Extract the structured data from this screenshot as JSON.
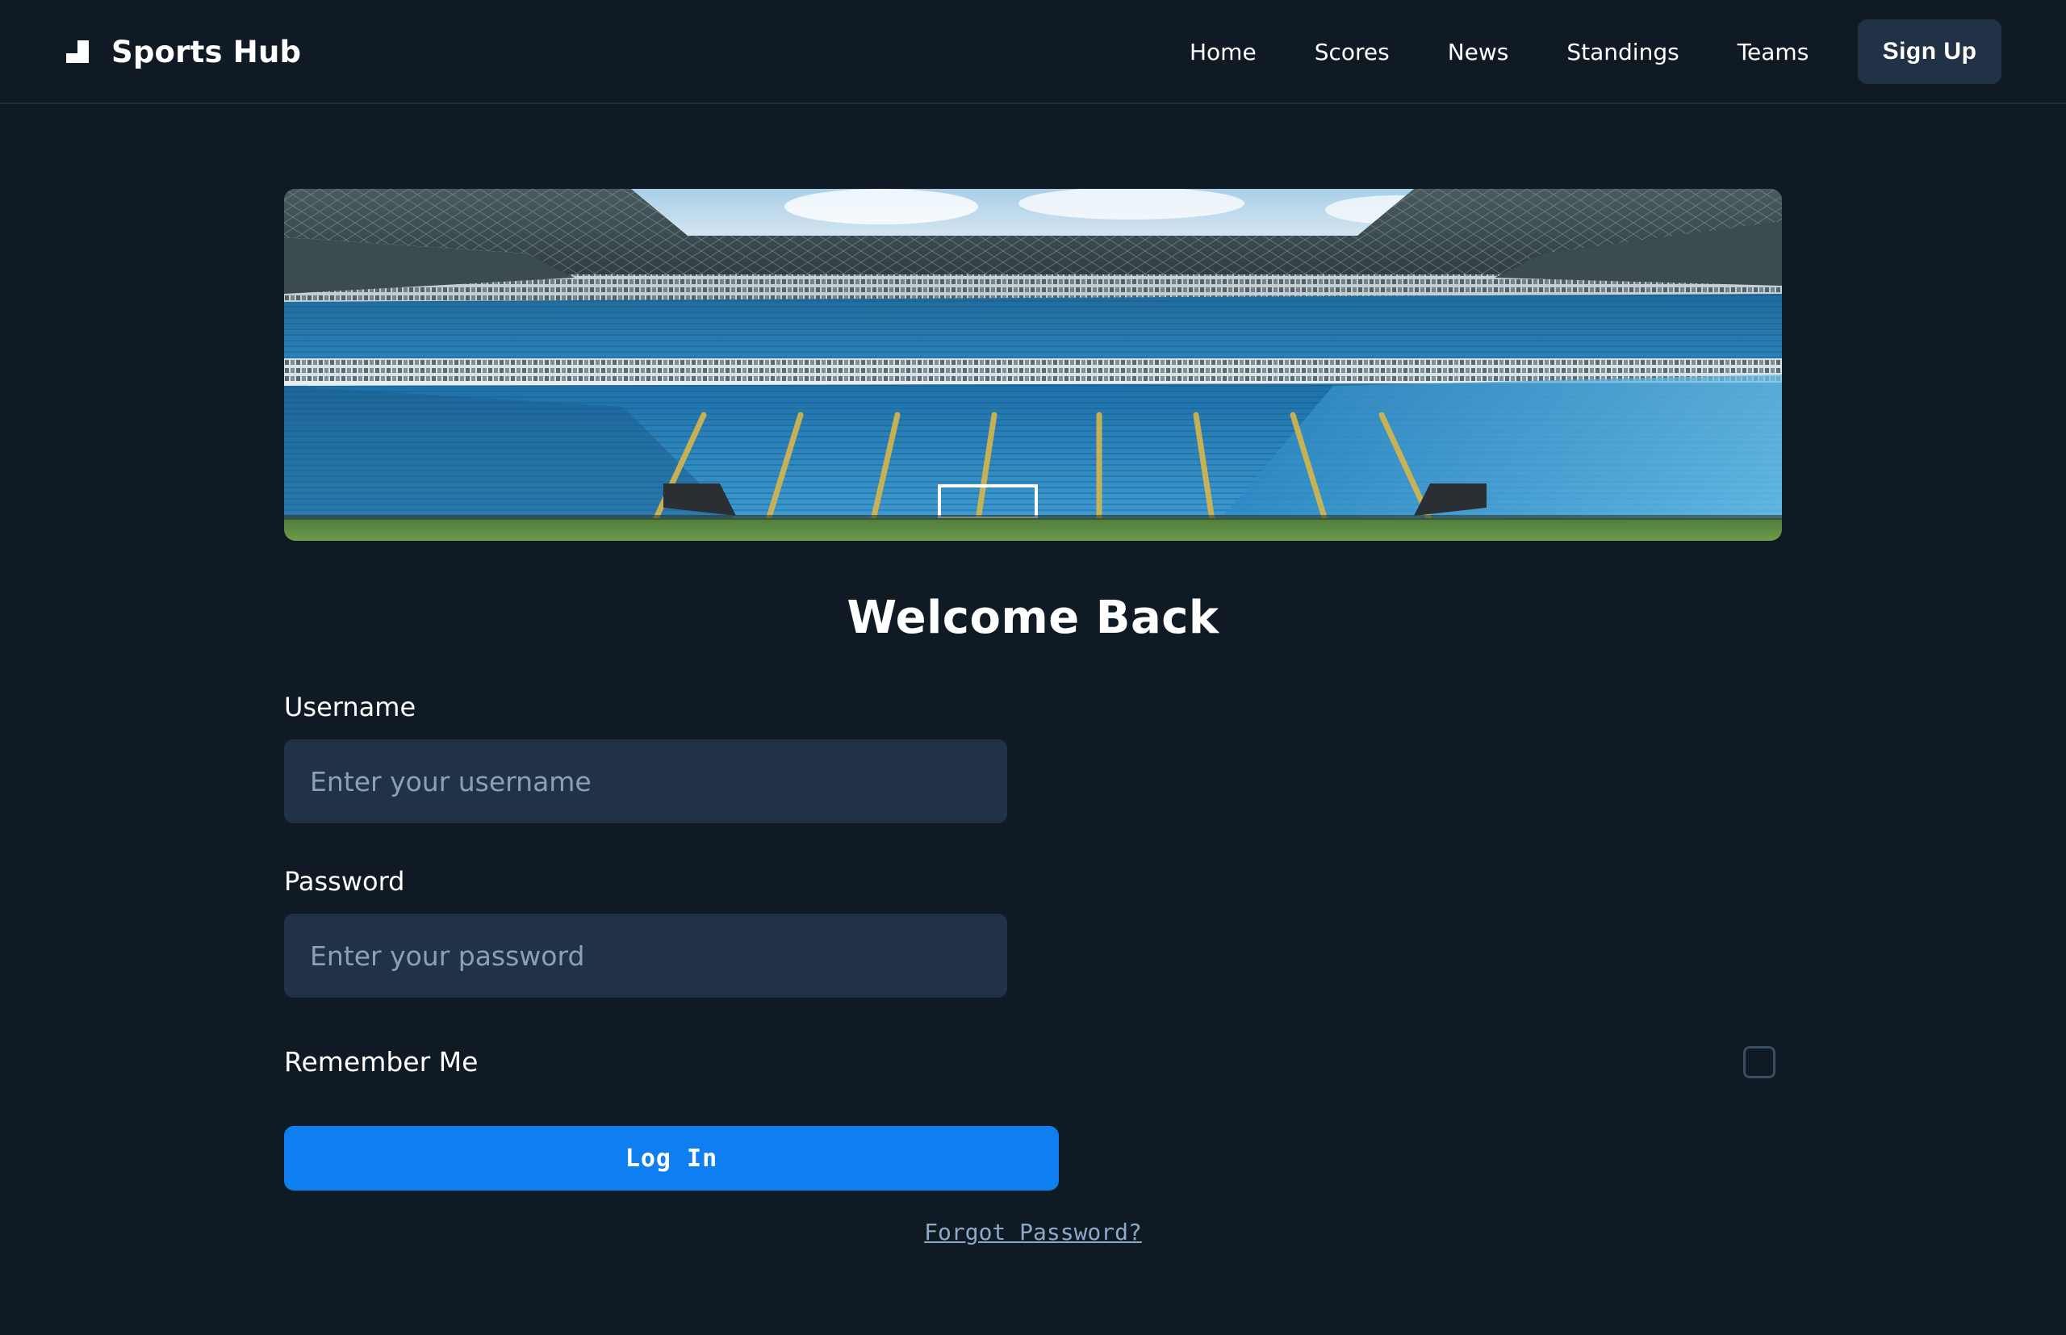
{
  "nav": {
    "brand_icon": "podium-icon",
    "brand_name": "Sports Hub",
    "links": [
      "Home",
      "Scores",
      "News",
      "Standings",
      "Teams"
    ],
    "signup_label": "Sign Up"
  },
  "hero": {
    "image": "football-stadium-photo"
  },
  "form": {
    "title": "Welcome Back",
    "username_label": "Username",
    "username_placeholder": "Enter your username",
    "password_label": "Password",
    "password_placeholder": "Enter your password",
    "remember_label": "Remember Me",
    "remember_checked": false,
    "login_label": "Log In",
    "forgot_label": "Forgot Password?"
  },
  "colors": {
    "background": "#101a24",
    "input_bg": "#213247",
    "primary": "#0f7ef0",
    "signup_bg": "#213246",
    "link": "#8fa8c8"
  }
}
